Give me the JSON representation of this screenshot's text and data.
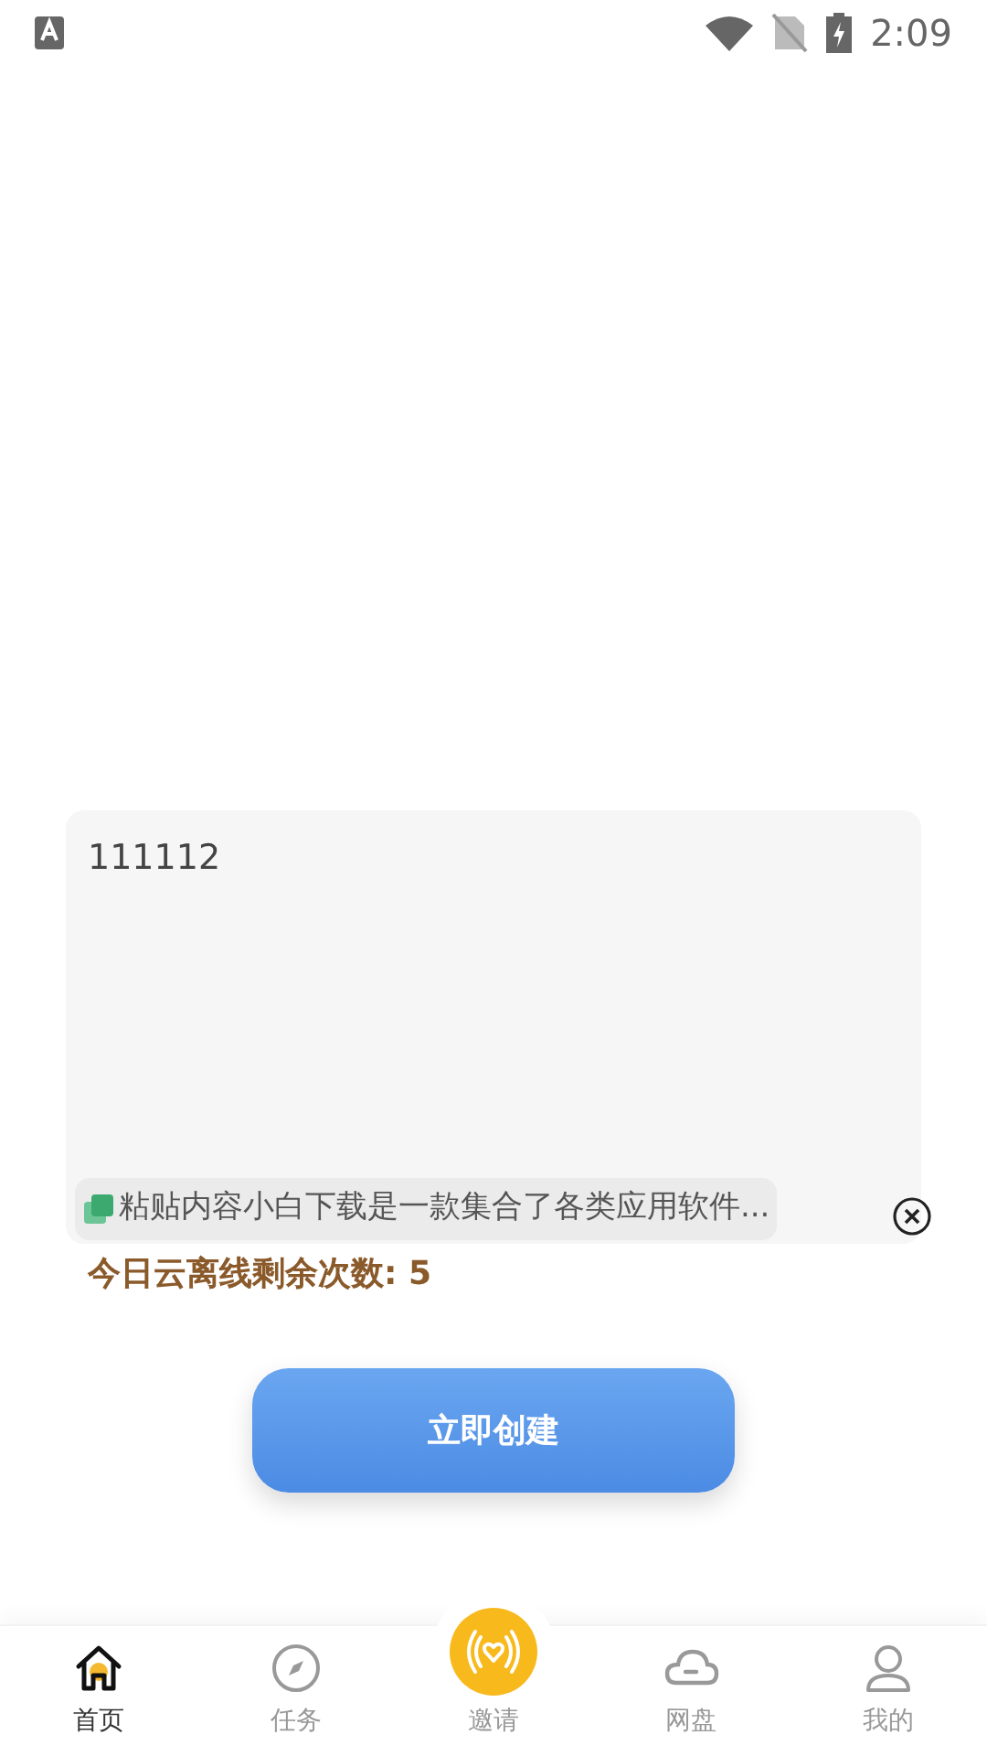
{
  "status_bar": {
    "time": "2:09"
  },
  "input": {
    "value": "111112"
  },
  "clipboard": {
    "text": "粘贴内容小白下载是一款集合了各类应用软件..."
  },
  "quota": {
    "text": "今日云离线剩余次数: 5"
  },
  "create_button": {
    "label": "立即创建"
  },
  "tabs": [
    {
      "kind": "home",
      "label": "首页",
      "selected": true
    },
    {
      "kind": "compass",
      "label": "任务",
      "selected": false
    },
    {
      "kind": "invite",
      "label": "邀请",
      "selected": false
    },
    {
      "kind": "cloud",
      "label": "网盘",
      "selected": false
    },
    {
      "kind": "user",
      "label": "我的",
      "selected": false
    }
  ]
}
